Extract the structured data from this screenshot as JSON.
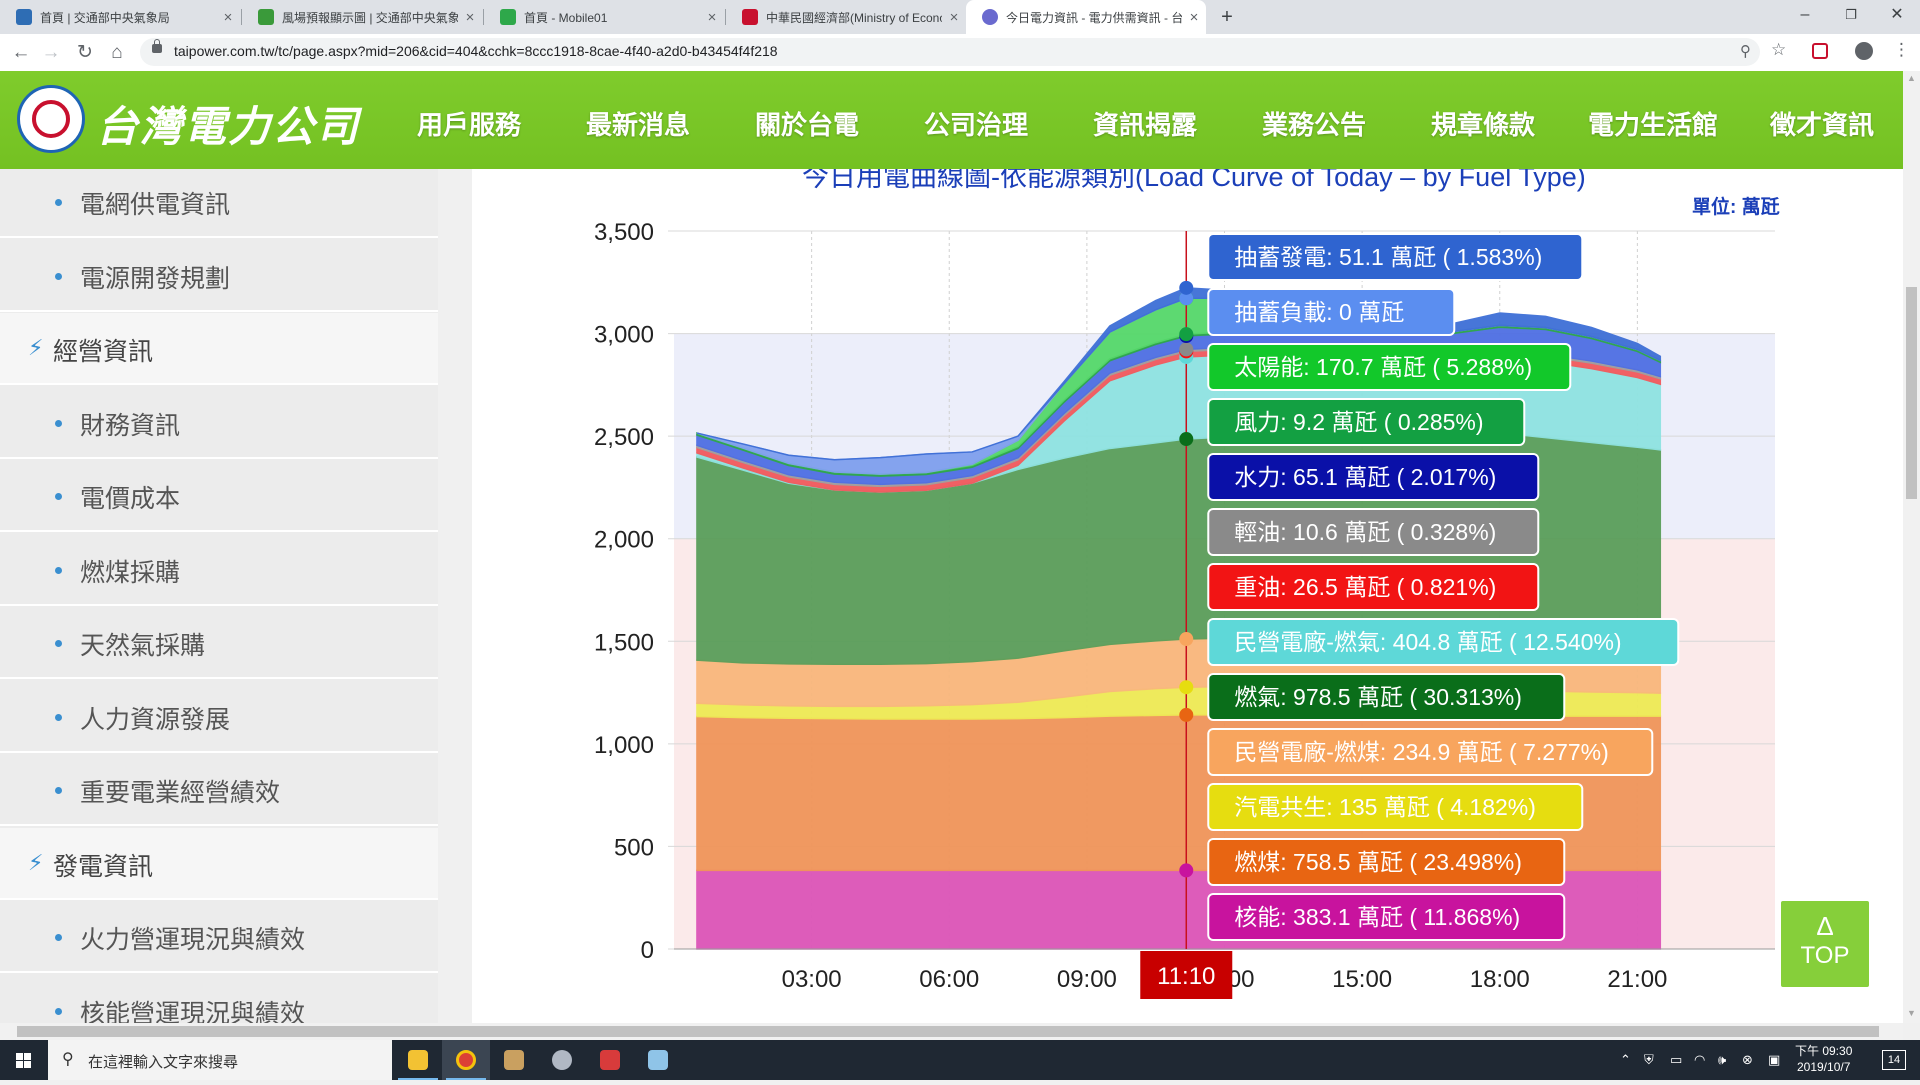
{
  "browser": {
    "tabs": [
      {
        "title": "首頁 | 交通部中央氣象局",
        "favicon_color": "#2e6db4"
      },
      {
        "title": "風場預報顯示圖 | 交通部中央氣象局",
        "favicon_color": "#3a9a3a"
      },
      {
        "title": "首頁 - Mobile01",
        "favicon_color": "#2ea84a"
      },
      {
        "title": "中華民國經濟部(Ministry of Economic Affairs)",
        "favicon_color": "#c8102e"
      },
      {
        "title": "今日電力資訊 - 電力供需資訊 - 台灣電力公司",
        "favicon_color": "#6a6acf",
        "active": true
      }
    ],
    "close_glyph": "×",
    "newtab_glyph": "+",
    "url": "taipower.com.tw/tc/page.aspx?mid=206&cid=404&cchk=8ccc1918-8cae-4f40-a2d0-b43454f4f218",
    "window_buttons": {
      "minimize": "–",
      "maximize": "❐",
      "close": "✕"
    }
  },
  "site": {
    "name": "台灣電力公司",
    "nav": [
      "用戶服務",
      "最新消息",
      "關於台電",
      "公司治理",
      "資訊揭露",
      "業務公告",
      "規章條款",
      "電力生活館",
      "徵才資訊"
    ]
  },
  "sidebar": {
    "items": [
      {
        "label": "電網供電資訊",
        "type": "sub"
      },
      {
        "label": "電源開發規劃",
        "type": "sub"
      },
      {
        "label": "經營資訊",
        "type": "category"
      },
      {
        "label": "財務資訊",
        "type": "sub"
      },
      {
        "label": "電價成本",
        "type": "sub"
      },
      {
        "label": "燃煤採購",
        "type": "sub"
      },
      {
        "label": "天然氣採購",
        "type": "sub"
      },
      {
        "label": "人力資源發展",
        "type": "sub"
      },
      {
        "label": "重要電業經營績效",
        "type": "sub"
      },
      {
        "label": "發電資訊",
        "type": "category"
      },
      {
        "label": "火力營運現況與績效",
        "type": "sub"
      },
      {
        "label": "核能營運現況與績效",
        "type": "sub"
      }
    ]
  },
  "chart_data": {
    "type": "area",
    "title": "今日用電曲線圖-依能源類別(Load Curve of Today – by Fuel Type)",
    "unit_label": "單位: 萬瓩",
    "y_ticks": [
      "0",
      "500",
      "1,000",
      "1,500",
      "2,000",
      "2,500",
      "3,000",
      "3,500"
    ],
    "x_ticks": [
      "03:00",
      "06:00",
      "09:00",
      "12:00",
      "15:00",
      "18:00",
      "21:00"
    ],
    "ylim": [
      0,
      3500
    ],
    "xlim_hours": [
      0,
      24
    ],
    "data_end_hour": 21.5,
    "cursor_time": "11:10",
    "cursor_hour": 11.1667,
    "series_bottom_to_top": [
      {
        "name": "核能",
        "color": "#dc55b8",
        "tooltip": "核能: 383.1 萬瓩 ( 11.868%)",
        "tip_color": "#c8139e",
        "values": [
          383,
          383,
          383,
          383,
          383,
          383,
          383,
          383,
          383,
          383,
          383,
          383,
          383,
          383,
          383,
          383,
          383,
          383,
          383,
          383,
          383,
          383,
          383
        ]
      },
      {
        "name": "燃煤",
        "color": "#f0955a",
        "tooltip": "燃煤: 758.5 萬瓩 ( 23.498%)",
        "tip_color": "#e86512",
        "values": [
          750,
          745,
          742,
          740,
          738,
          738,
          738,
          740,
          745,
          752,
          756,
          758,
          758,
          758,
          758,
          756,
          754,
          752,
          752,
          752,
          752,
          752,
          752
        ]
      },
      {
        "name": "汽電共生",
        "color": "#eeea55",
        "tooltip": "汽電共生: 135 萬瓩 ( 4.182%)",
        "tip_color": "#e6dd10",
        "values": [
          65,
          62,
          60,
          60,
          62,
          65,
          70,
          80,
          100,
          120,
          130,
          135,
          138,
          135,
          132,
          132,
          130,
          128,
          125,
          122,
          118,
          115,
          112
        ]
      },
      {
        "name": "民營電廠-燃煤",
        "color": "#f9b77c",
        "tooltip": "民營電廠-燃煤: 234.9 萬瓩 ( 7.277%)",
        "tip_color": "#f8a55e",
        "values": [
          210,
          205,
          205,
          205,
          205,
          205,
          210,
          215,
          225,
          230,
          233,
          235,
          236,
          236,
          236,
          236,
          236,
          236,
          236,
          236,
          236,
          236,
          236
        ]
      },
      {
        "name": "燃氣",
        "color": "#5a9e5a",
        "tooltip": "燃氣: 978.5 萬瓩 ( 30.313%)",
        "tip_color": "#0a6e1a",
        "values": [
          990,
          940,
          880,
          850,
          840,
          845,
          870,
          920,
          940,
          955,
          965,
          975,
          980,
          985,
          990,
          995,
          1000,
          1010,
          1020,
          1000,
          980,
          960,
          950
        ]
      },
      {
        "name": "民營電廠-燃氣",
        "color": "#8fe3e1",
        "tooltip": "民營電廠-燃氣: 404.8 萬瓩 ( 12.540%)",
        "tip_color": "#5ed8d8",
        "values": [
          20,
          10,
          5,
          0,
          0,
          0,
          0,
          20,
          180,
          330,
          380,
          400,
          400,
          400,
          395,
          390,
          385,
          380,
          378,
          370,
          360,
          340,
          320
        ]
      },
      {
        "name": "重油",
        "color": "#f2595c",
        "tooltip": "重油: 26.5 萬瓩 ( 0.821%)",
        "tip_color": "#f21414",
        "values": [
          27,
          27,
          27,
          27,
          27,
          27,
          27,
          27,
          27,
          27,
          27,
          27,
          27,
          27,
          27,
          27,
          27,
          27,
          27,
          27,
          27,
          27,
          27
        ]
      },
      {
        "name": "輕油",
        "color": "#a0a0a0",
        "tooltip": "輕油: 10.6 萬瓩 ( 0.328%)",
        "tip_color": "#8a8a8a",
        "values": [
          10,
          10,
          10,
          10,
          10,
          10,
          10,
          10,
          10,
          10,
          10,
          10,
          10,
          10,
          10,
          10,
          10,
          10,
          10,
          10,
          10,
          10,
          10
        ]
      },
      {
        "name": "水力",
        "color": "#4f6fe3",
        "tooltip": "水力: 65.1 萬瓩 ( 2.017%)",
        "tip_color": "#0a10a8",
        "values": [
          50,
          50,
          45,
          40,
          40,
          40,
          40,
          45,
          55,
          60,
          63,
          65,
          66,
          66,
          66,
          68,
          70,
          75,
          100,
          120,
          110,
          90,
          70
        ]
      },
      {
        "name": "風力",
        "color": "#2fa84a",
        "tooltip": "風力: 9.2 萬瓩 ( 0.285%)",
        "tip_color": "#13a042",
        "values": [
          10,
          10,
          10,
          10,
          10,
          10,
          10,
          10,
          10,
          10,
          9,
          9,
          9,
          9,
          9,
          9,
          9,
          9,
          9,
          9,
          9,
          9,
          9
        ]
      },
      {
        "name": "太陽能",
        "color": "#55d86a",
        "tooltip": "太陽能: 170.7 萬瓩 ( 5.288%)",
        "tip_color": "#12c82a",
        "values": [
          0,
          0,
          0,
          0,
          0,
          0,
          5,
          30,
          80,
          130,
          160,
          175,
          165,
          140,
          100,
          55,
          15,
          0,
          0,
          0,
          0,
          0,
          0
        ]
      },
      {
        "name": "抽蓄負載",
        "color": "#7fa0ee",
        "tooltip": "抽蓄負載: 0 萬瓩",
        "tip_color": "#5b8ef0",
        "values": [
          0,
          20,
          40,
          60,
          80,
          90,
          60,
          20,
          0,
          0,
          0,
          0,
          0,
          0,
          0,
          0,
          0,
          0,
          0,
          0,
          0,
          0,
          0
        ]
      },
      {
        "name": "抽蓄發電",
        "color": "#3e6fd6",
        "tooltip": "抽蓄發電: 51.1 萬瓩 ( 1.583%)",
        "tip_color": "#2f64d0",
        "values": [
          0,
          0,
          0,
          0,
          0,
          0,
          0,
          0,
          10,
          30,
          45,
          51,
          40,
          30,
          20,
          15,
          25,
          40,
          60,
          55,
          45,
          30,
          20
        ]
      }
    ],
    "x_hours": [
      0.5,
      1.5,
      2.5,
      3.5,
      4.5,
      5.5,
      6.5,
      7.5,
      8.5,
      9.5,
      10.5,
      11.1667,
      12,
      13,
      14,
      15,
      16,
      17,
      18,
      19,
      20,
      21,
      21.5
    ],
    "background_bands": [
      {
        "from": 0,
        "to": 2000,
        "color": "#fbeaea"
      },
      {
        "from": 2000,
        "to": 3000,
        "color": "#eceefa"
      }
    ]
  },
  "top_button": {
    "arrow": "Δ",
    "label": "TOP"
  },
  "taskbar": {
    "search_placeholder": "在這裡輸入文字來搜尋",
    "time": "下午 09:30",
    "date": "2019/10/7",
    "notification_count": "14"
  }
}
